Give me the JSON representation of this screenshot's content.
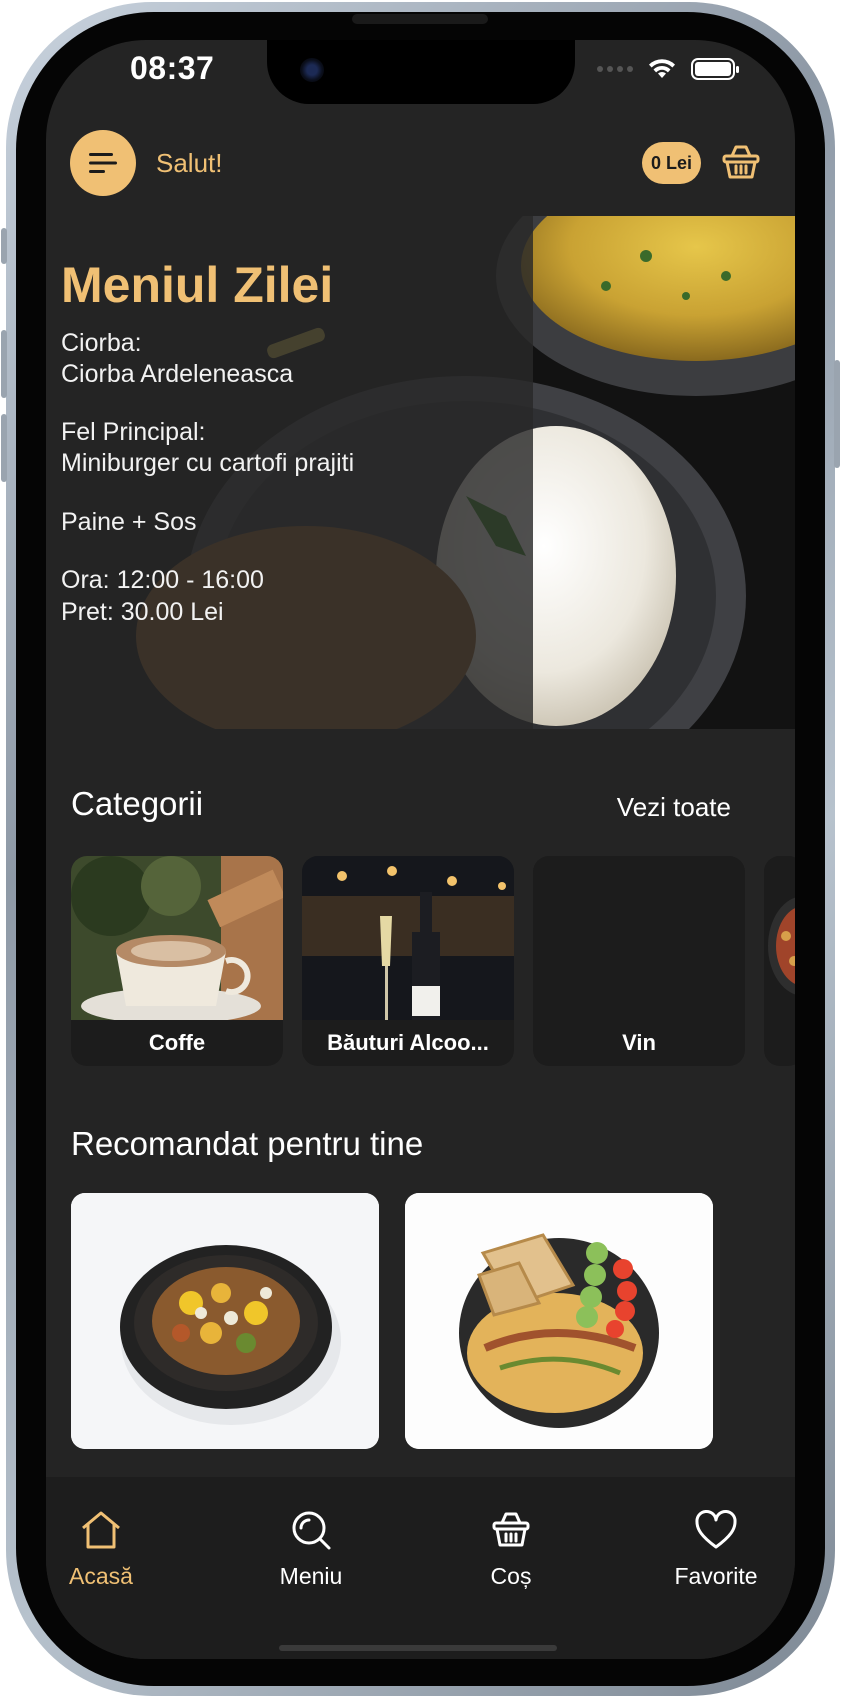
{
  "status_bar": {
    "time": "08:37"
  },
  "header": {
    "greeting": "Salut!",
    "cart_total": "0 Lei"
  },
  "daily_menu": {
    "title": "Meniul Zilei",
    "soup_label": "Ciorba:",
    "soup": "Ciorba Ardeleneasca",
    "main_label": "Fel Principal:",
    "main": "Miniburger cu cartofi prajiti",
    "extras": "Paine + Sos",
    "hours": "Ora: 12:00 - 16:00",
    "price": "Pret: 30.00 Lei"
  },
  "categories": {
    "title": "Categorii",
    "see_all": "Vezi toate",
    "items": [
      {
        "label": "Coffe"
      },
      {
        "label": "Băuturi Alcoo..."
      },
      {
        "label": "Vin"
      }
    ]
  },
  "recommended": {
    "title": "Recomandat pentru tine"
  },
  "tabbar": {
    "items": [
      {
        "label": "Acasă",
        "icon": "home-icon"
      },
      {
        "label": "Meniu",
        "icon": "search-icon"
      },
      {
        "label": "Coș",
        "icon": "basket-icon"
      },
      {
        "label": "Favorite",
        "icon": "heart-icon"
      }
    ]
  },
  "colors": {
    "accent": "#f0c074",
    "background": "#242424",
    "tabbar": "#1d1d1d"
  }
}
